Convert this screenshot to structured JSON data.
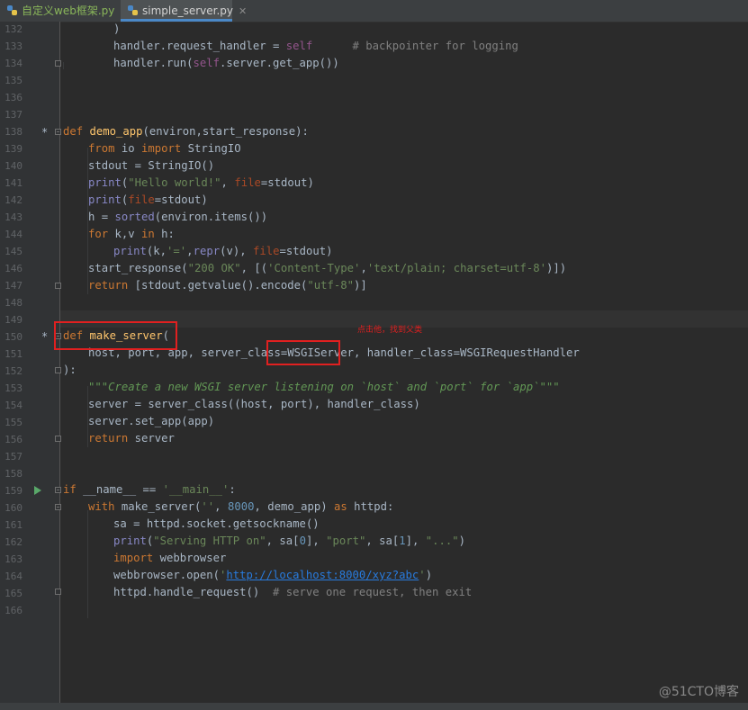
{
  "tabs": [
    {
      "label": "自定义web框架.py",
      "close": "✕",
      "icon": "python-file-icon"
    },
    {
      "label": "simple_server.py",
      "close": "✕",
      "icon": "python-file-icon"
    }
  ],
  "line_numbers": [
    "132",
    "133",
    "134",
    "135",
    "136",
    "137",
    "138",
    "139",
    "140",
    "141",
    "142",
    "143",
    "144",
    "145",
    "146",
    "147",
    "148",
    "149",
    "150",
    "151",
    "152",
    "153",
    "154",
    "155",
    "156",
    "157",
    "158",
    "159",
    "160",
    "161",
    "162",
    "163",
    "164",
    "165",
    "166"
  ],
  "code": {
    "l132": ")",
    "l133": {
      "a": "handler.request_handler = ",
      "b": "self",
      "c": "      ",
      "d": "# backpointer for logging"
    },
    "l134": {
      "a": "handler.run(",
      "b": "self",
      "c": ".server.get_app())"
    },
    "l138": {
      "a": "def ",
      "b": "demo_app",
      "c": "(environ,start_response):"
    },
    "l139": {
      "a": "from ",
      "b": "io ",
      "c": "import ",
      "d": "StringIO"
    },
    "l140": "stdout = StringIO()",
    "l141": {
      "a": "print",
      "b": "(",
      "c": "\"Hello world!\"",
      "d": ", ",
      "e": "file",
      "f": "=stdout)"
    },
    "l142": {
      "a": "print",
      "b": "(",
      "c": "file",
      "d": "=stdout)"
    },
    "l143": {
      "a": "h = ",
      "b": "sorted",
      "c": "(environ.items())"
    },
    "l144": {
      "a": "for ",
      "b": "k,v ",
      "c": "in ",
      "d": "h:"
    },
    "l145": {
      "a": "print",
      "b": "(k,",
      "c": "'='",
      "d": ",",
      "e": "repr",
      "f": "(v), ",
      "g": "file",
      "h": "=stdout)"
    },
    "l146": {
      "a": "start_response(",
      "b": "\"200 OK\"",
      "c": ", [(",
      "d": "'Content-Type'",
      "e": ",",
      "f": "'text/plain; charset=utf-8'",
      "g": ")])"
    },
    "l147": {
      "a": "return ",
      "b": "[stdout.getvalue().encode(",
      "c": "\"utf-8\"",
      "d": ")]"
    },
    "l150": {
      "a": "def ",
      "b": "make_server",
      "c": "("
    },
    "l151": {
      "a": "host, port, app, server_class=WSGIServer, handler_class=WSGIRequestHandler"
    },
    "l152": "):",
    "l153": "\"\"\"Create a new WSGI server listening on `host` and `port` for `app`\"\"\"",
    "l154": "server = server_class((host, port), handler_class)",
    "l155": "server.set_app(app)",
    "l156": {
      "a": "return ",
      "b": "server"
    },
    "l159": {
      "a": "if ",
      "b": "__name__ == ",
      "c": "'__main__'",
      "d": ":"
    },
    "l160": {
      "a": "with ",
      "b": "make_server(",
      "c": "''",
      "d": ", ",
      "e": "8000",
      "f": ", demo_app) ",
      "g": "as ",
      "h": "httpd:"
    },
    "l161": "sa = httpd.socket.getsockname()",
    "l162": {
      "a": "print",
      "b": "(",
      "c": "\"Serving HTTP on\"",
      "d": ", sa[",
      "e": "0",
      "f": "], ",
      "g": "\"port\"",
      "h": ", sa[",
      "i": "1",
      "j": "], ",
      "k": "\"...\"",
      "l": ")"
    },
    "l163": {
      "a": "import ",
      "b": "webbrowser"
    },
    "l164": {
      "a": "webbrowser.open(",
      "b": "'",
      "c": "http://localhost:8000/xyz?abc",
      "d": "'",
      "e": ")"
    },
    "l165": {
      "a": "httpd.handle_request()  ",
      "b": "# serve one request, then exit"
    }
  },
  "gutter_marks": {
    "modified": "*"
  },
  "annotation": "点击他，找到父类",
  "watermark": "@51CTO博客",
  "colors": {
    "keyword": "#cc7832",
    "function": "#ffc66d",
    "string": "#6a8759",
    "number": "#6897bb",
    "comment": "#808080",
    "highlight_box": "#e02020"
  }
}
